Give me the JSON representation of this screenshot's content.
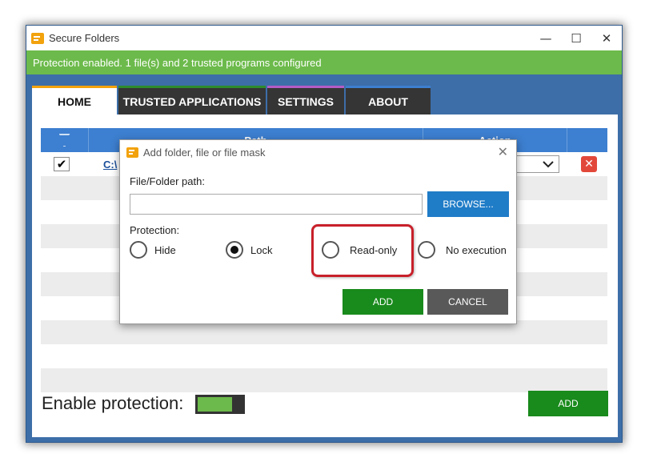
{
  "window": {
    "title": "Secure Folders",
    "controls": {
      "minimize": "—",
      "maximize": "☐",
      "close": "✕"
    }
  },
  "status": {
    "text": "Protection enabled. 1 file(s) and 2 trusted programs configured"
  },
  "tabs": [
    {
      "label": "HOME",
      "active": true
    },
    {
      "label": "TRUSTED APPLICATIONS",
      "active": false
    },
    {
      "label": "SETTINGS",
      "active": false
    },
    {
      "label": "ABOUT",
      "active": false
    }
  ],
  "table": {
    "columns": {
      "path": "Path",
      "action": "Action"
    },
    "rows": [
      {
        "checked": true,
        "check_glyph": "✔",
        "path": "C:\\",
        "action": "",
        "delete_glyph": "✕"
      }
    ]
  },
  "footer": {
    "protection_label": "Enable protection:",
    "protection_on": true,
    "add_label": "ADD"
  },
  "dialog": {
    "title": "Add folder, file or file mask",
    "close_glyph": "✕",
    "path_label": "File/Folder path:",
    "path_value": "",
    "browse_label": "BROWSE...",
    "protection_label": "Protection:",
    "options": [
      {
        "label": "Hide",
        "checked": false
      },
      {
        "label": "Lock",
        "checked": true
      },
      {
        "label": "Read-only",
        "checked": false
      },
      {
        "label": "No execution",
        "checked": false
      }
    ],
    "add_label": "ADD",
    "cancel_label": "CANCEL"
  },
  "colors": {
    "status_green": "#6cba4b",
    "header_blue": "#3d7fd0",
    "add_green": "#198a1c",
    "highlight_red": "#c8202a"
  }
}
